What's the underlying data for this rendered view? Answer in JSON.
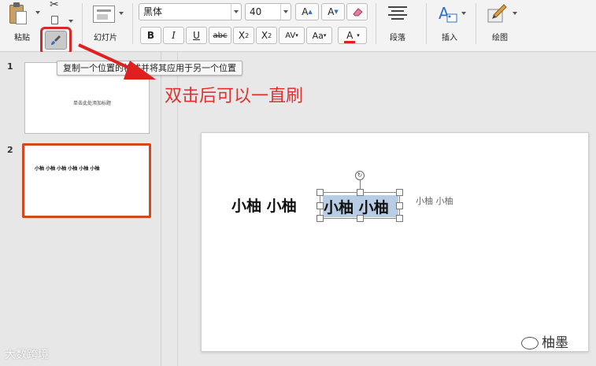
{
  "ribbon": {
    "paste_label": "粘贴",
    "slides_label": "幻灯片",
    "font_name": "黑体",
    "font_size": "40",
    "grow_font": "A",
    "shrink_font": "A",
    "bold": "B",
    "italic": "I",
    "underline": "U",
    "strikethrough": "abc",
    "superscript": "X",
    "subscript": "X",
    "char_spacing": "AV",
    "change_case": "Aa",
    "font_color": "A",
    "paragraph_label": "段落",
    "insert_label": "插入",
    "draw_label": "绘图",
    "font_color_swatch": "#e02020"
  },
  "tooltip": "复制一个位置的格式并将其应用于另一个位置",
  "annotation": "双击后可以一直刷",
  "thumbnails": [
    {
      "number": "1",
      "text": "单击此处添加标题"
    },
    {
      "number": "2",
      "text": "小柚 小柚  小柚 小柚  小柚 小柚"
    }
  ],
  "slide": {
    "text_left": "小柚  小柚",
    "text_selected": "小柚  小柚",
    "text_small": "小柚 小柚",
    "rotate_symbol": "↻"
  },
  "watermarks": {
    "left": "大数跨境",
    "right": "柚墨"
  }
}
